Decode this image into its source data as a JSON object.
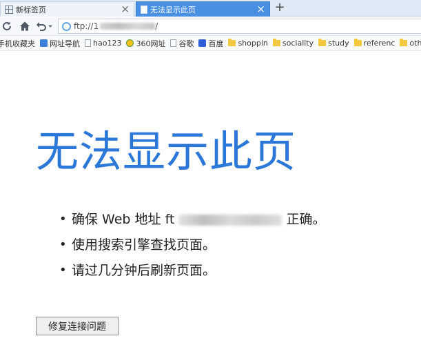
{
  "tabs": [
    {
      "label": "新标签页",
      "active": false
    },
    {
      "label": "无法显示此页",
      "active": true
    }
  ],
  "tab_close_glyph": "×",
  "new_tab_glyph": "+",
  "toolbar": {
    "refresh_icon": "refresh-icon",
    "home_icon": "home-icon",
    "undo_icon": "undo-icon",
    "address_prefix": "ftp://1",
    "address_suffix": "/"
  },
  "bookmarks": [
    {
      "label": "手机收藏夹",
      "icon": "phone-icon"
    },
    {
      "label": "网址导航",
      "icon": "nav-icon"
    },
    {
      "label": "hao123",
      "icon": "page-icon"
    },
    {
      "label": "360网址",
      "icon": "360-icon"
    },
    {
      "label": "谷歌",
      "icon": "page-icon"
    },
    {
      "label": "百度",
      "icon": "baidu-icon"
    },
    {
      "label": "shoppin",
      "icon": "folder-icon"
    },
    {
      "label": "sociality",
      "icon": "folder-icon"
    },
    {
      "label": "study",
      "icon": "folder-icon"
    },
    {
      "label": "referenc",
      "icon": "folder-icon"
    },
    {
      "label": "others",
      "icon": "folder-icon"
    }
  ],
  "error": {
    "title": "无法显示此页",
    "bullets": {
      "check_prefix": "确保 Web 地址",
      "check_url_start": "ft",
      "check_suffix": "正确。",
      "search": "使用搜索引擎查找页面。",
      "refresh": "请过几分钟后刷新页面。"
    },
    "fix_button": "修复连接问题"
  },
  "colors": {
    "accent": "#2b78d8",
    "active_tab": "#4a90e2"
  }
}
